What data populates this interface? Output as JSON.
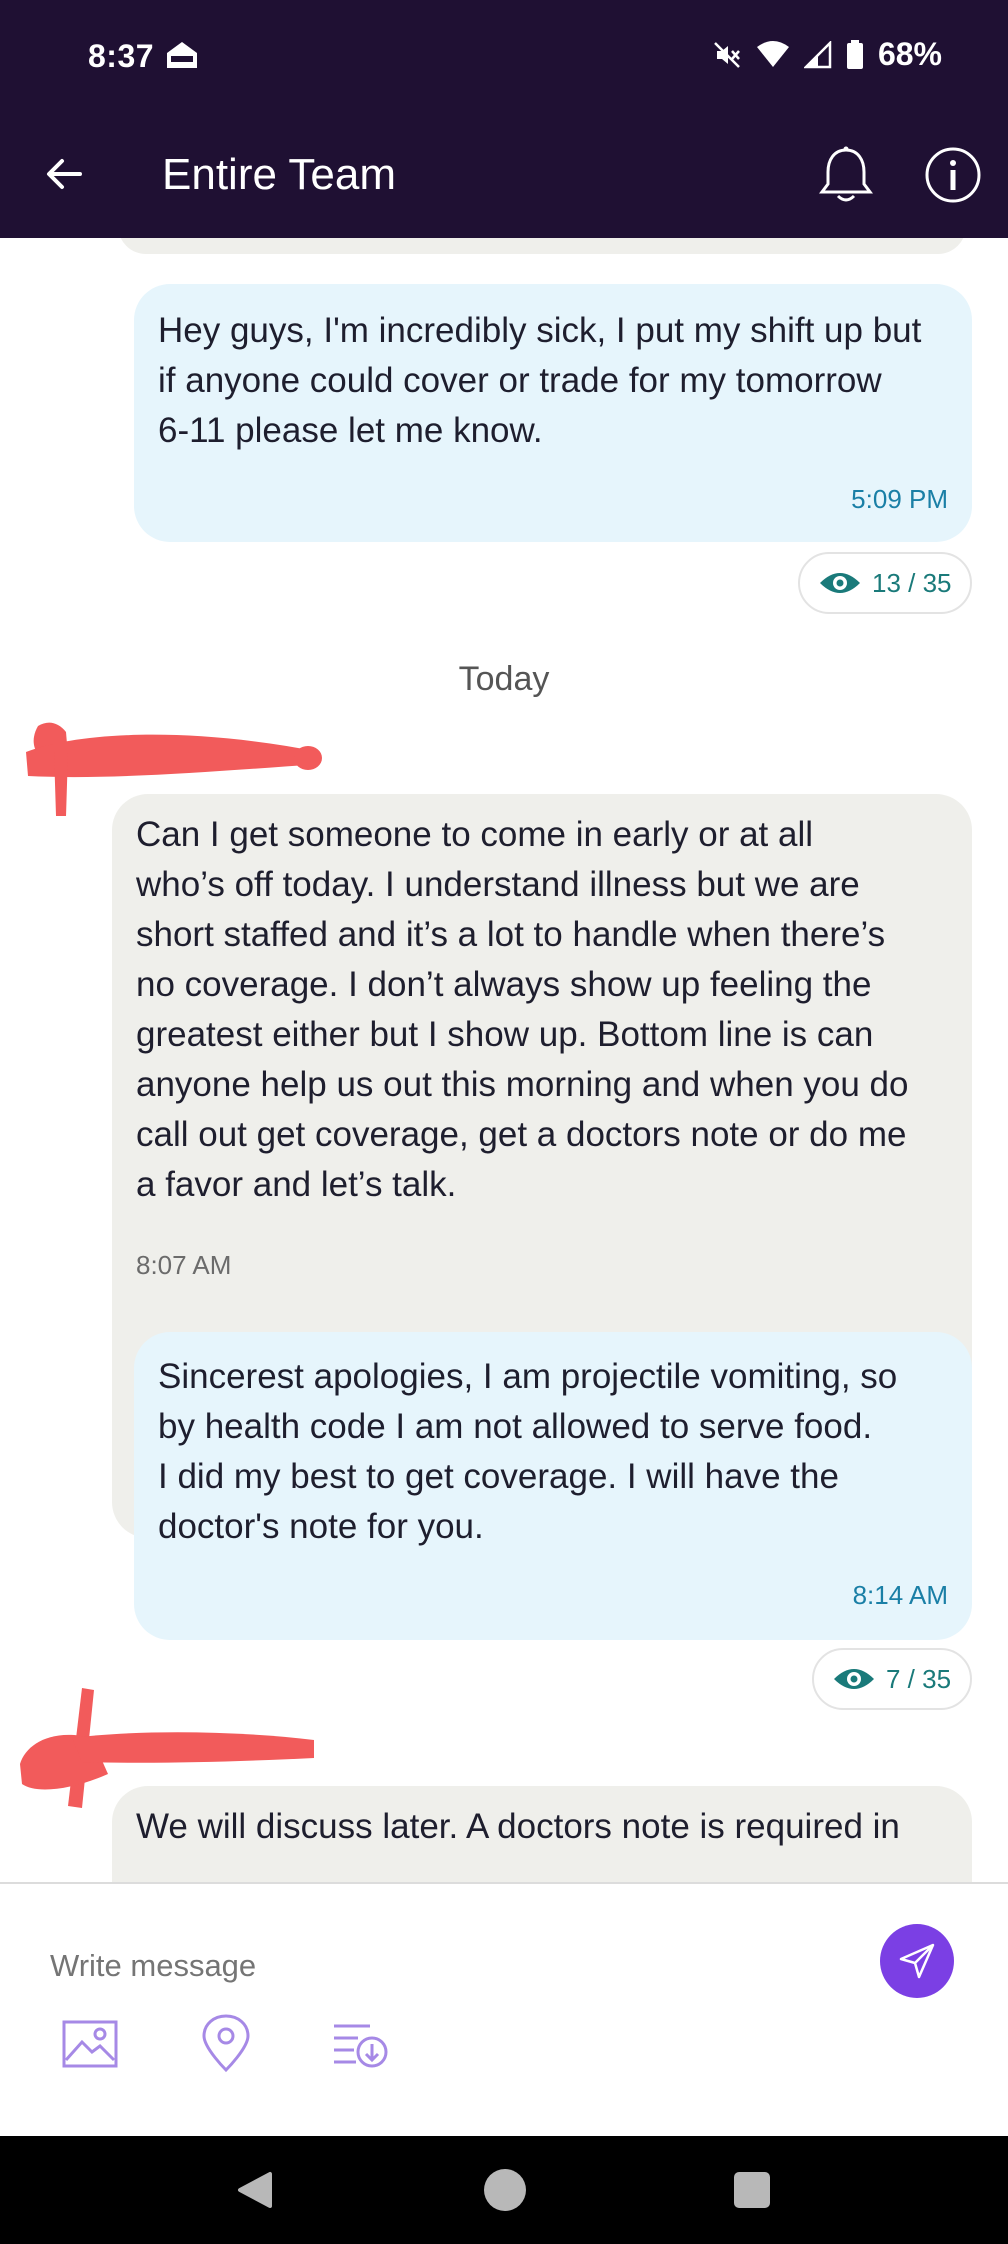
{
  "status_bar": {
    "time": "8:37",
    "battery": "68%",
    "icons": [
      "roku-icon",
      "mute-icon",
      "wifi-icon",
      "signal-icon",
      "battery-icon"
    ]
  },
  "header": {
    "title": "Entire Team",
    "icons": [
      "back-arrow-icon",
      "bell-icon",
      "info-icon"
    ],
    "background": "#1f1033"
  },
  "messages": [
    {
      "side": "mine",
      "lines": [
        "Hey guys, I'm incredibly sick, I put my shift up but",
        "if anyone could cover or trade for my tomorrow",
        "6-11 please let me know."
      ],
      "time": "5:09 PM",
      "seen": "13 / 35"
    },
    {
      "side": "theirs",
      "lines": [
        "Can I get someone to come in early or at all",
        "who’s off today. I understand illness but we are",
        "short staffed and it’s a lot to handle when there’s",
        "no coverage. I don’t always show up feeling the",
        "greatest either but I show up. Bottom line is can",
        "anyone help us out this morning and when you do",
        "call out get coverage, get a doctors note or do me",
        "a favor and let’s talk."
      ],
      "time": "8:07 AM"
    },
    {
      "side": "mine",
      "lines": [
        "Sincerest apologies, I am projectile vomiting, so",
        "by health code I am not allowed to serve food.",
        "I did my best to get coverage. I will have the",
        "doctor's note for you."
      ],
      "time": "8:14 AM",
      "seen": "7 / 35"
    },
    {
      "side": "theirs",
      "lines": [
        "We will discuss later. A doctors note is required in"
      ]
    }
  ],
  "date_separator": "Today",
  "composer": {
    "placeholder": "Write message",
    "tools": [
      "image-icon",
      "location-pin-icon",
      "list-download-icon"
    ],
    "send_icon": "send-icon"
  },
  "colors": {
    "accent": "#7b3fe4",
    "my_bubble": "#e6f5fc",
    "their_bubble": "#efefeb",
    "seen_text": "#1a7a7a",
    "time_mine": "#1a7fa6",
    "redaction": "#f25b5b"
  }
}
